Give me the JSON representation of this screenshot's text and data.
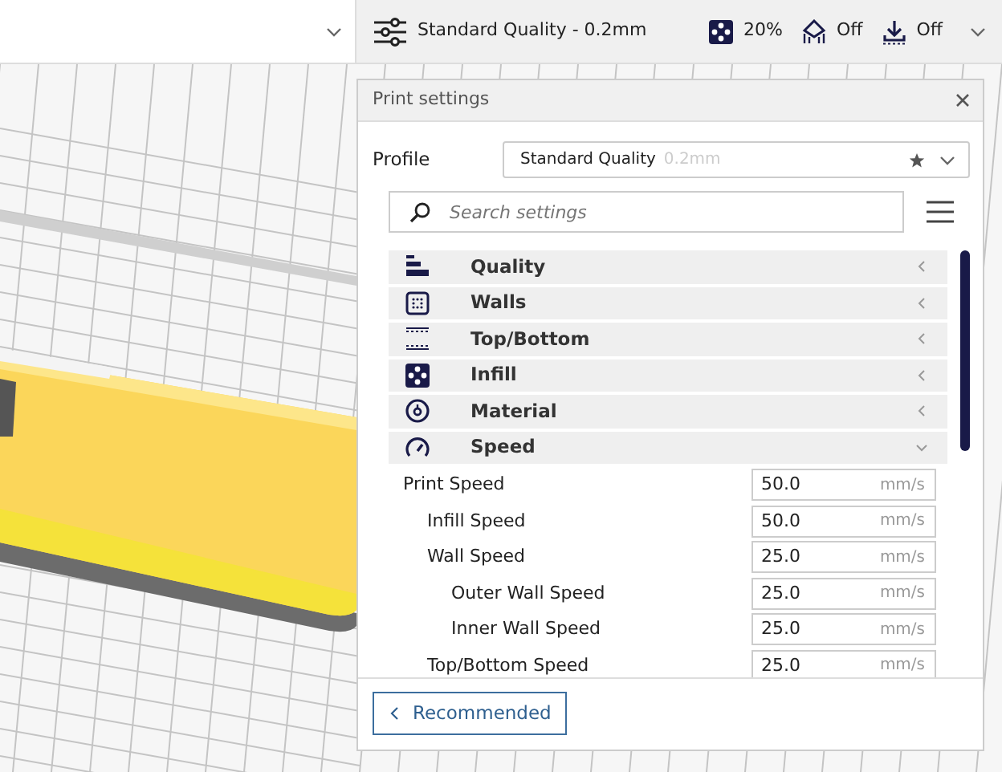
{
  "top_bar": {
    "profile_summary": "Standard Quality - 0.2mm",
    "infill": "20%",
    "support": "Off",
    "adhesion": "Off"
  },
  "print_settings": {
    "title": "Print settings",
    "profile_label": "Profile",
    "profile_name": "Standard Quality",
    "profile_detail": "0.2mm",
    "search_placeholder": "Search settings",
    "categories": [
      {
        "kind": "quality",
        "label": "Quality",
        "expanded": false
      },
      {
        "kind": "walls",
        "label": "Walls",
        "expanded": false
      },
      {
        "kind": "top_bottom",
        "label": "Top/Bottom",
        "expanded": false
      },
      {
        "kind": "infill",
        "label": "Infill",
        "expanded": false
      },
      {
        "kind": "material",
        "label": "Material",
        "expanded": false
      },
      {
        "kind": "speed",
        "label": "Speed",
        "expanded": true
      }
    ],
    "settings": [
      {
        "label": "Print Speed",
        "value": "50.0",
        "unit": "mm/s",
        "children": [
          {
            "label": "Infill Speed",
            "value": "50.0",
            "unit": "mm/s"
          },
          {
            "label": "Wall Speed",
            "value": "25.0",
            "unit": "mm/s",
            "children": [
              {
                "label": "Outer Wall Speed",
                "value": "25.0",
                "unit": "mm/s"
              },
              {
                "label": "Inner Wall Speed",
                "value": "25.0",
                "unit": "mm/s"
              }
            ]
          },
          {
            "label": "Top/Bottom Speed",
            "value": "25.0",
            "unit": "mm/s"
          }
        ]
      }
    ],
    "mode_button": "Recommended"
  }
}
